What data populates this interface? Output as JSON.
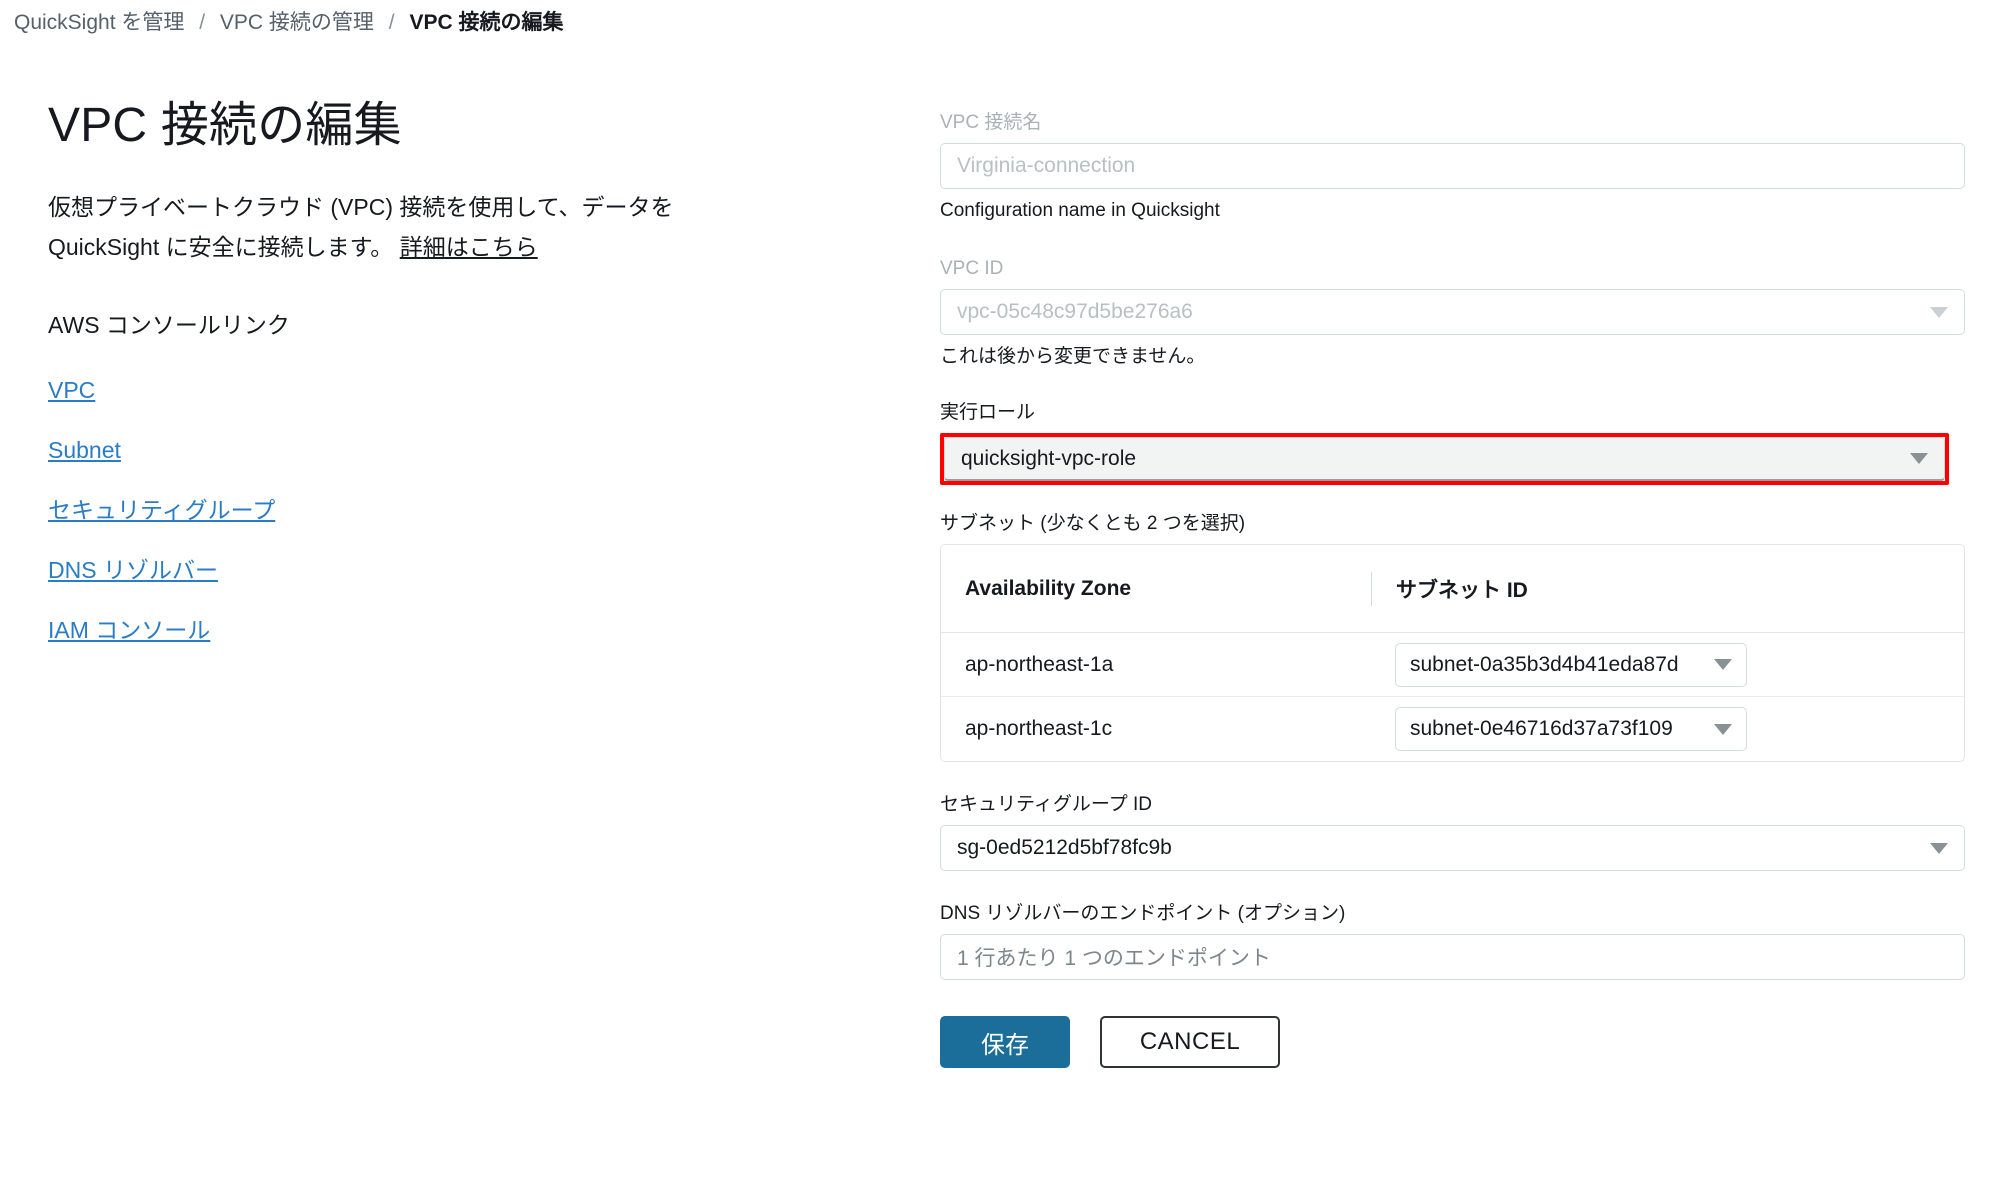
{
  "breadcrumb": {
    "separator": "/",
    "items": [
      {
        "label": "QuickSight を管理",
        "current": false
      },
      {
        "label": "VPC 接続の管理",
        "current": false
      },
      {
        "label": "VPC 接続の編集",
        "current": true
      }
    ]
  },
  "left": {
    "title": "VPC 接続の編集",
    "intro_text": "仮想プライベートクラウド (VPC) 接続を使用して、データを QuickSight に安全に接続します。",
    "intro_link": "詳細はこちら",
    "console_links_heading": "AWS コンソールリンク",
    "links": [
      {
        "label": "VPC"
      },
      {
        "label": "Subnet"
      },
      {
        "label": "セキュリティグループ"
      },
      {
        "label": "DNS リゾルバー"
      },
      {
        "label": "IAM コンソール"
      }
    ]
  },
  "form": {
    "connection_name": {
      "label": "VPC 接続名",
      "value": "Virginia-connection",
      "helper": "Configuration name in Quicksight",
      "disabled": true
    },
    "vpc_id": {
      "label": "VPC ID",
      "value": "vpc-05c48c97d5be276a6",
      "helper": "これは後から変更できません。",
      "disabled": true
    },
    "execution_role": {
      "label": "実行ロール",
      "value": "quicksight-vpc-role",
      "highlighted": true,
      "highlight_color": "#ff0000"
    },
    "subnets": {
      "label": "サブネット (少なくとも 2 つを選択)",
      "columns": [
        "Availability Zone",
        "サブネット ID"
      ],
      "rows": [
        {
          "az": "ap-northeast-1a",
          "subnet_id": "subnet-0a35b3d4b41eda87d"
        },
        {
          "az": "ap-northeast-1c",
          "subnet_id": "subnet-0e46716d37a73f109"
        }
      ]
    },
    "security_group": {
      "label": "セキュリティグループ ID",
      "value": "sg-0ed5212d5bf78fc9b"
    },
    "dns_resolver": {
      "label": "DNS リゾルバーのエンドポイント (オプション)",
      "placeholder": "1 行あたり 1 つのエンドポイント",
      "value": ""
    },
    "buttons": {
      "save": "保存",
      "cancel": "CANCEL"
    }
  },
  "colors": {
    "link": "#2a7cc7",
    "primary_button": "#1b6d9a",
    "highlight": "#ff0000"
  }
}
